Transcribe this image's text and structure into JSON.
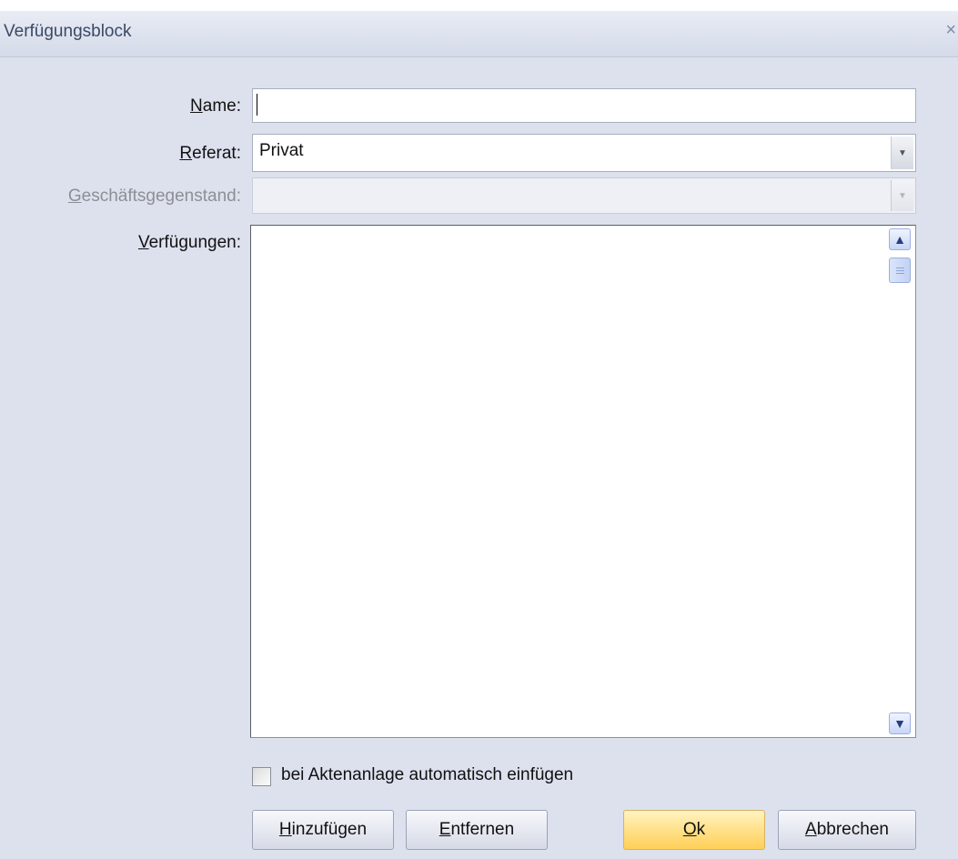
{
  "dialog": {
    "title": "Verfügungsblock",
    "close_icon": "close-icon"
  },
  "form": {
    "name": {
      "label_mn": "N",
      "label_rest": "ame:",
      "value": ""
    },
    "referat": {
      "label_mn": "R",
      "label_rest": "eferat:",
      "value": "Privat"
    },
    "geschaeftsgegenstand": {
      "label_mn": "G",
      "label_rest": "eschäftsgegenstand:",
      "value": ""
    },
    "verfuegungen": {
      "label_mn": "V",
      "label_rest": "erfügungen:"
    },
    "auto_insert": {
      "label": "bei Aktenanlage automatisch einfügen",
      "checked": false
    }
  },
  "buttons": {
    "hinzufuegen": {
      "mn": "H",
      "rest": "inzufügen"
    },
    "entfernen": {
      "mn": "E",
      "rest": "ntfernen"
    },
    "ok": {
      "mn": "O",
      "rest": "k"
    },
    "abbrechen": {
      "mn": "A",
      "rest": "bbrechen"
    }
  },
  "colors": {
    "dialog_bg": "#dde1ee",
    "ok_accent": "#ffd86e"
  }
}
